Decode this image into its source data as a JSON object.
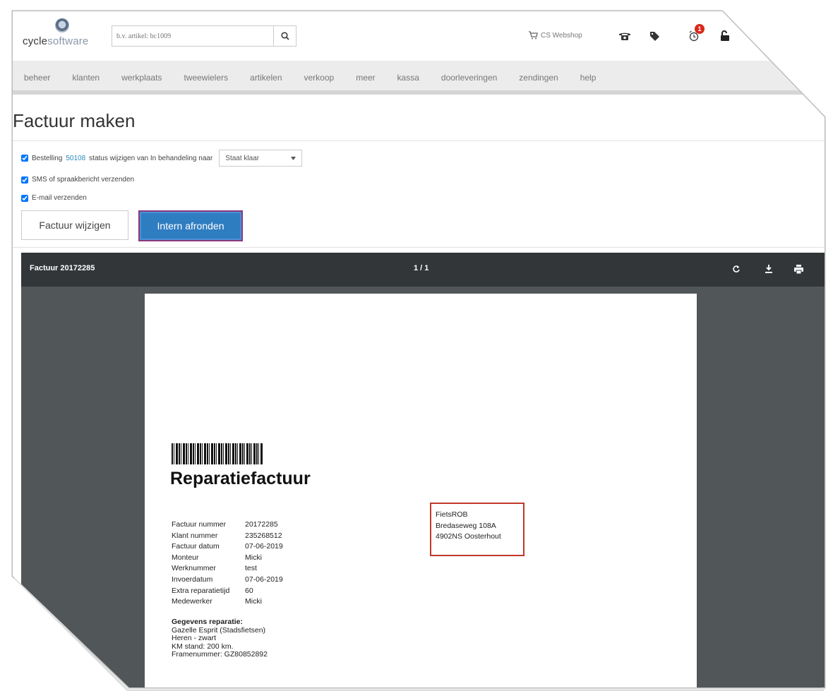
{
  "header": {
    "logo": {
      "part1": "cycle",
      "part2": "software"
    },
    "search": {
      "placeholder": "b.v. artikel: bc1009"
    },
    "webshop_label": "CS Webshop",
    "alarm_badge": "1"
  },
  "nav": {
    "items": [
      "beheer",
      "klanten",
      "werkplaats",
      "tweewielers",
      "artikelen",
      "verkoop",
      "meer",
      "kassa",
      "doorleveringen",
      "zendingen",
      "help"
    ]
  },
  "page": {
    "title": "Factuur maken"
  },
  "options": {
    "status_prefix": "Bestelling",
    "order_number": "50108",
    "status_suffix": "status wijzigen van In behandeling naar",
    "status_select": "Staat klaar",
    "sms_label": "SMS of spraakbericht verzenden",
    "email_label": "E-mail verzenden"
  },
  "buttons": {
    "edit": "Factuur wijzigen",
    "finish": "Intern afronden"
  },
  "viewer": {
    "title": "Factuur 20172285",
    "page": "1 / 1"
  },
  "document": {
    "title": "Reparatiefactuur",
    "fields": [
      {
        "label": "Factuur nummer",
        "value": "20172285"
      },
      {
        "label": "Klant nummer",
        "value": "235268512"
      },
      {
        "label": "Factuur datum",
        "value": "07-06-2019"
      },
      {
        "label": "Monteur",
        "value": "Micki"
      },
      {
        "label": "Werknummer",
        "value": "test"
      },
      {
        "label": "Invoerdatum",
        "value": "07-06-2019"
      },
      {
        "label": "Extra reparatietijd",
        "value": "60"
      },
      {
        "label": "Medewerker",
        "value": "Micki"
      }
    ],
    "repair": {
      "heading": "Gegevens reparatie:",
      "lines": [
        "Gazelle Esprit (Stadsfietsen)",
        "Heren - zwart",
        "KM stand: 200 km.",
        "Framenummer: GZ80852892"
      ]
    },
    "address": [
      "FietsROB",
      "Bredaseweg 108A",
      "4902NS Oosterhout"
    ]
  },
  "colors": {
    "primary": "#2f7dc1",
    "link": "#2a8bb8",
    "viewer_bar": "#323639",
    "viewer_bg": "#515658",
    "highlight": "#c0392b"
  }
}
